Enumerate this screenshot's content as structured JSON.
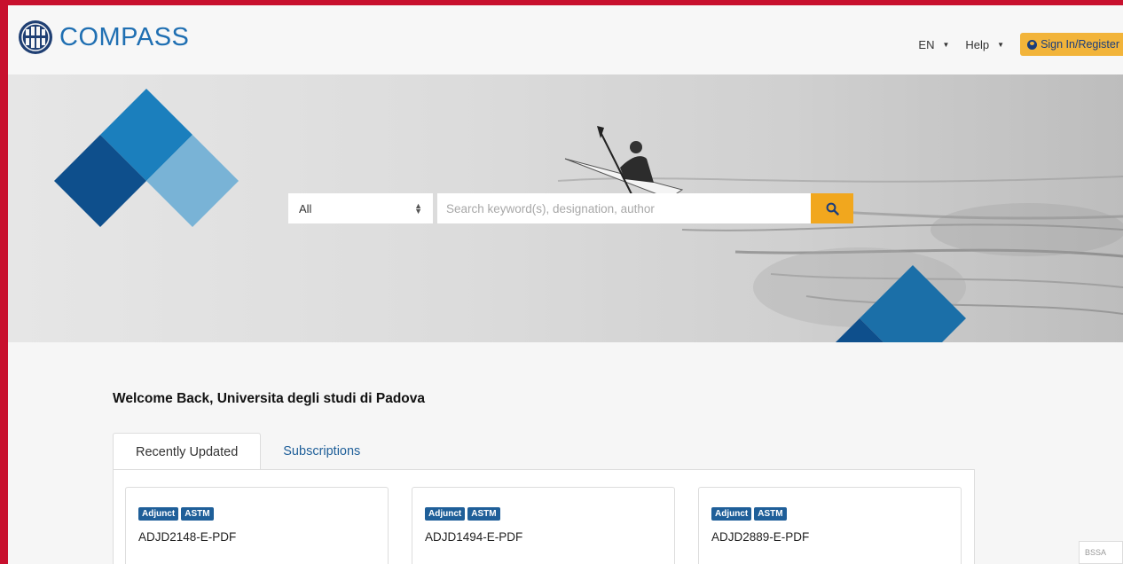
{
  "header": {
    "brand_name": "COMPASS",
    "logo_icon": "astm-logo-icon",
    "language": "EN",
    "help": "Help",
    "sign_in": "Sign In/Register",
    "accent": "#f2b43a"
  },
  "search": {
    "category_selected": "All",
    "placeholder": "Search keyword(s), designation, author",
    "button_icon": "search-icon",
    "button_color": "#f1a71e"
  },
  "welcome": {
    "text": "Welcome Back, Universita  degli studi di Padova"
  },
  "tabs": [
    {
      "label": "Recently Updated",
      "active": true
    },
    {
      "label": "Subscriptions",
      "active": false
    }
  ],
  "cards": [
    {
      "badges": [
        "Adjunct",
        "ASTM"
      ],
      "title": "ADJD2148-E-PDF"
    },
    {
      "badges": [
        "Adjunct",
        "ASTM"
      ],
      "title": "ADJD1494-E-PDF"
    },
    {
      "badges": [
        "Adjunct",
        "ASTM"
      ],
      "title": "ADJD2889-E-PDF"
    }
  ],
  "corner_badge": "BSSA",
  "colors": {
    "brand_blue": "#1f6fb2",
    "badge_blue": "#1f5f99",
    "frame_red": "#c8102e"
  }
}
